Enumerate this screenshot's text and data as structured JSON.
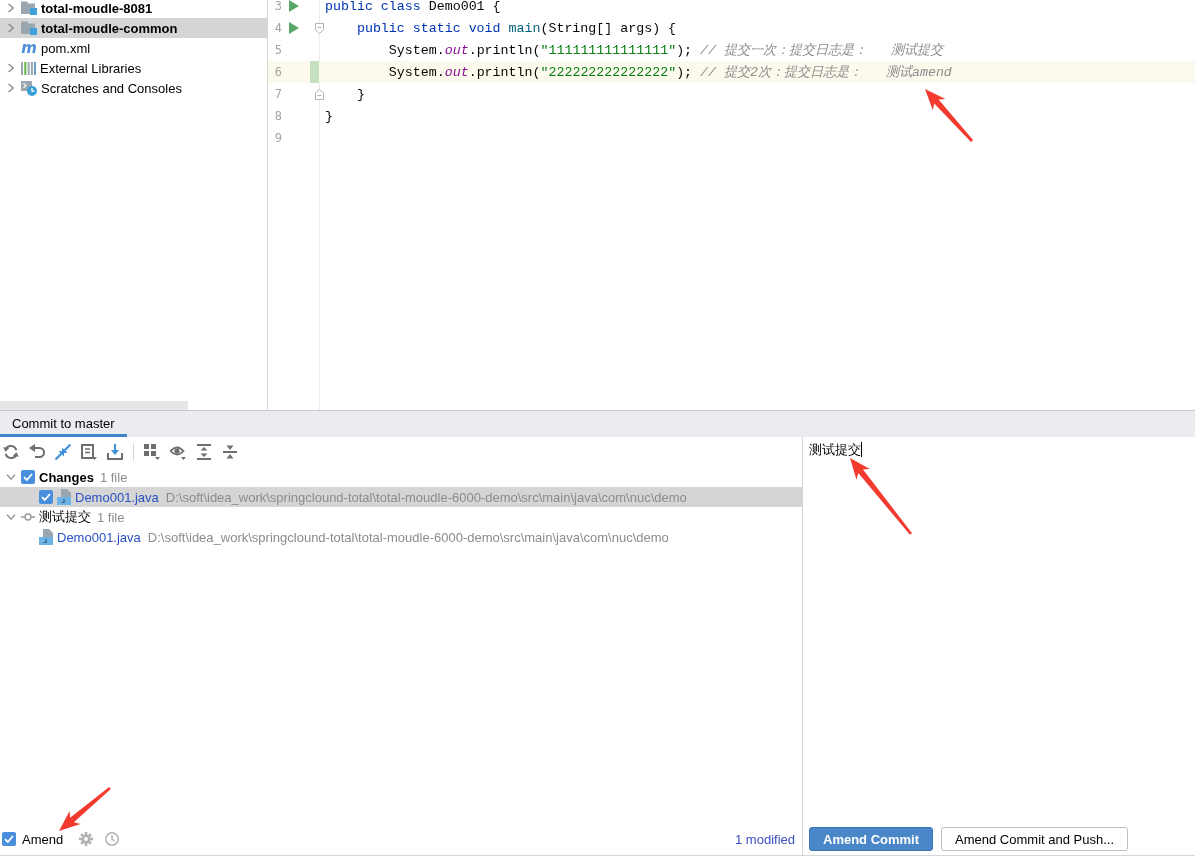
{
  "project_tree": {
    "items": [
      {
        "children": [
          {
            "kind": "module",
            "label": "total-moudle-8081",
            "expanded": false,
            "selected": false
          },
          {
            "kind": "module",
            "label": "total-moudle-common",
            "expanded": false,
            "selected": true
          },
          {
            "kind": "maven",
            "icon": "m",
            "label": "pom.xml",
            "selected": false
          }
        ]
      },
      {
        "kind": "libraries",
        "label": "External Libraries",
        "expanded": false,
        "selected": false
      },
      {
        "kind": "scratches",
        "label": "Scratches and Consoles",
        "expanded": false,
        "selected": false
      }
    ]
  },
  "editor": {
    "lines": [
      {
        "number": "3",
        "run": true,
        "fold_start": false,
        "fold_end": false,
        "current": false,
        "changed": false,
        "tokens": [
          {
            "kind": "keyword",
            "text": "public class "
          },
          {
            "kind": "plain",
            "text": "Demo001 {"
          }
        ]
      },
      {
        "number": "4",
        "run": true,
        "fold_start": true,
        "fold_end": false,
        "current": false,
        "changed": false,
        "tokens": [
          {
            "kind": "keyword",
            "text": "    public static void "
          },
          {
            "kind": "method",
            "text": "main"
          },
          {
            "kind": "plain",
            "text": "(String[] args) {"
          }
        ]
      },
      {
        "number": "5",
        "run": false,
        "fold_start": false,
        "fold_end": false,
        "current": false,
        "changed": false,
        "tokens": [
          {
            "kind": "plain",
            "text": "        System."
          },
          {
            "kind": "field",
            "text": "out"
          },
          {
            "kind": "plain",
            "text": ".println("
          },
          {
            "kind": "string",
            "text": "\"111111111111111\""
          },
          {
            "kind": "plain",
            "text": "); "
          },
          {
            "kind": "comment",
            "text": "// 提交一次：提交日志是：   测试提交"
          }
        ]
      },
      {
        "number": "6",
        "run": false,
        "fold_start": false,
        "fold_end": false,
        "current": true,
        "changed": true,
        "tokens": [
          {
            "kind": "plain",
            "text": "        System."
          },
          {
            "kind": "field",
            "text": "out"
          },
          {
            "kind": "plain",
            "text": ".println("
          },
          {
            "kind": "string",
            "text": "\"222222222222222\""
          },
          {
            "kind": "plain",
            "text": "); "
          },
          {
            "kind": "comment",
            "text": "// 提交2次：提交日志是：   测试amend"
          }
        ]
      },
      {
        "number": "7",
        "run": false,
        "fold_start": false,
        "fold_end": true,
        "current": false,
        "changed": false,
        "tokens": [
          {
            "kind": "plain",
            "text": "    }"
          }
        ]
      },
      {
        "number": "8",
        "run": false,
        "fold_start": false,
        "fold_end": false,
        "current": false,
        "changed": false,
        "tokens": [
          {
            "kind": "plain",
            "text": "}"
          }
        ]
      },
      {
        "number": "9",
        "run": false,
        "fold_start": false,
        "fold_end": false,
        "current": false,
        "changed": false
      }
    ]
  },
  "commit_panel": {
    "tabs": [
      {
        "label": "Commit to master",
        "selected": true
      }
    ],
    "changes": [
      {
        "kind": "changelist",
        "label": "Changes",
        "count": "1 file",
        "expanded": true,
        "checked": true,
        "selected": false,
        "children": [
          {
            "kind": "file",
            "label": "Demo001.java",
            "path": "D:\\soft\\idea_work\\springclound-total\\total-moudle-6000-demo\\src\\main\\java\\com\\nuc\\demo",
            "checked": true,
            "selected": true
          }
        ]
      },
      {
        "kind": "commit",
        "label": "测试提交",
        "count": "1 file",
        "expanded": true,
        "selected": false,
        "children": [
          {
            "kind": "file",
            "label": "Demo001.java",
            "path": "D:\\soft\\idea_work\\springclound-total\\total-moudle-6000-demo\\src\\main\\java\\com\\nuc\\demo",
            "selected": false
          }
        ]
      }
    ],
    "amend": {
      "label": "Amend",
      "checked": true
    },
    "status": "1 modified",
    "message": {
      "value": "测试提交"
    },
    "buttons": [
      {
        "label": "Amend Commit",
        "primary": true
      },
      {
        "label": "Amend Commit and Push...",
        "primary": false
      }
    ]
  },
  "overlay_marks": [
    {
      "kind": "arrow"
    },
    {
      "kind": "arrow"
    },
    {
      "kind": "arrow"
    }
  ]
}
